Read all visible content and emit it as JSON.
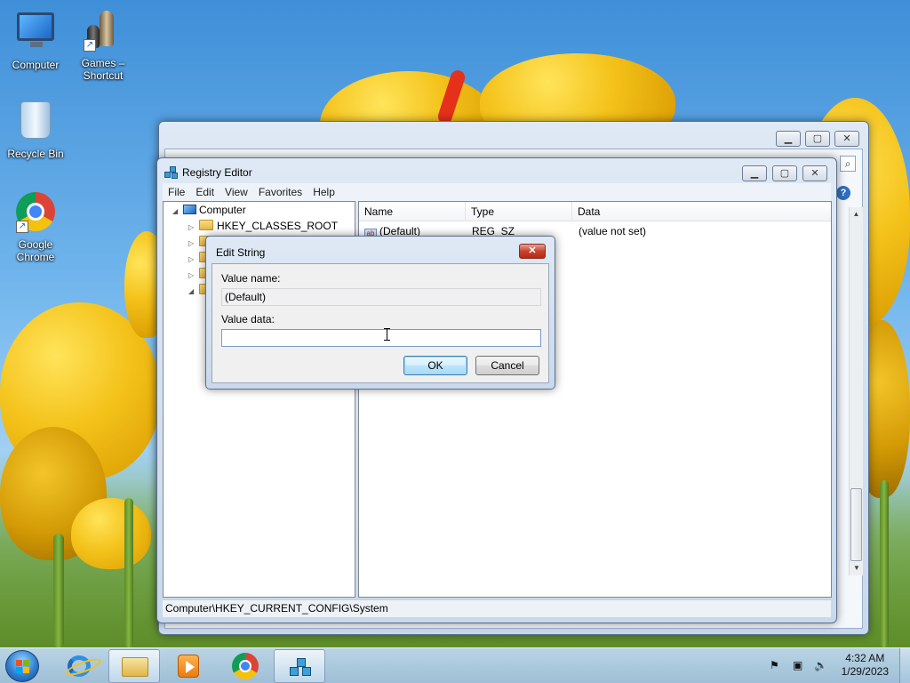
{
  "desktop": {
    "icons": [
      {
        "label": "Computer"
      },
      {
        "label": "Games – Shortcut"
      },
      {
        "label": "Recycle Bin"
      },
      {
        "label": "Google Chrome"
      }
    ]
  },
  "regedit": {
    "title": "Registry Editor",
    "menu": [
      "File",
      "Edit",
      "View",
      "Favorites",
      "Help"
    ],
    "tree": {
      "root": "Computer",
      "first_child": "HKEY_CLASSES_ROOT"
    },
    "columns": [
      "Name",
      "Type",
      "Data"
    ],
    "values": [
      {
        "name": "(Default)",
        "type": "REG_SZ",
        "data": "(value not set)"
      }
    ],
    "status_path": "Computer\\HKEY_CURRENT_CONFIG\\System"
  },
  "dialog": {
    "title": "Edit String",
    "value_name_label": "Value name:",
    "value_name": "(Default)",
    "value_data_label": "Value data:",
    "value_data": "",
    "ok_label": "OK",
    "cancel_label": "Cancel"
  },
  "taskbar": {
    "time": "4:32 AM",
    "date": "1/29/2023"
  },
  "icons": {
    "start": "windows-start-orb",
    "ie": "internet-explorer-icon",
    "explorer": "folder-icon",
    "media": "media-player-icon",
    "chrome": "chrome-icon",
    "regedit": "registry-editor-icon",
    "tray": [
      "action-center-flag-icon",
      "network-icon",
      "volume-muted-icon"
    ]
  },
  "colors": {
    "accent": "#3c7fb1",
    "close_red": "#c7432d",
    "tulip_yellow": "#f4c21a"
  }
}
